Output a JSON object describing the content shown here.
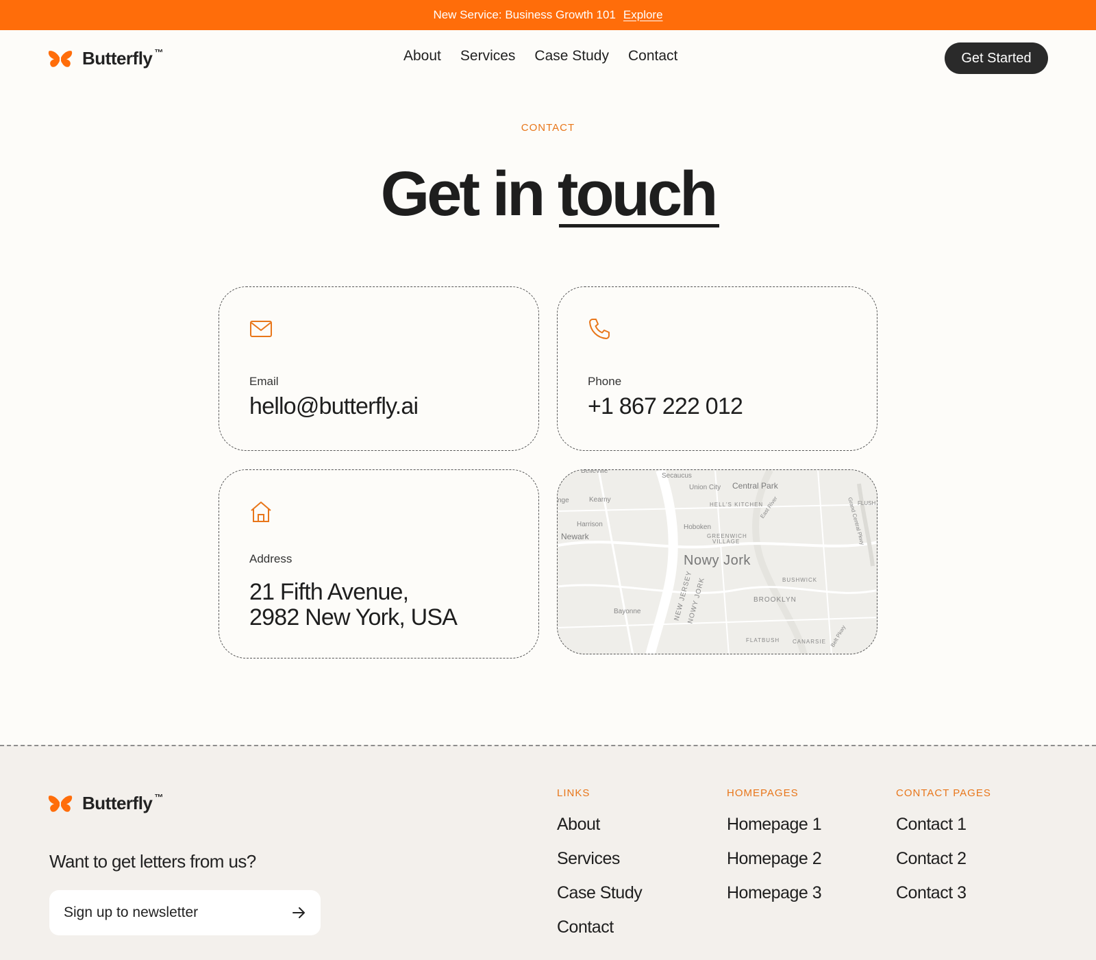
{
  "announcement": {
    "text": "New Service: Business Growth 101",
    "link": "Explore"
  },
  "brand": {
    "name": "Butterfly",
    "mark": "™",
    "accent": "#ff6d0a"
  },
  "nav": {
    "items": [
      "About",
      "Services",
      "Case Study",
      "Contact"
    ],
    "cta": "Get Started"
  },
  "hero": {
    "eyebrow": "CONTACT",
    "title_plain": "Get in ",
    "title_underlined": "touch"
  },
  "cards": {
    "email": {
      "icon": "mail-icon",
      "label": "Email",
      "value": "hello@butterfly.ai"
    },
    "phone": {
      "icon": "phone-icon",
      "label": "Phone",
      "value": "+1 867 222 012"
    },
    "address": {
      "icon": "home-icon",
      "label": "Address",
      "line1": "21 Fifth Avenue,",
      "line2": "2982 New York, USA"
    }
  },
  "map": {
    "main_city": "Nowy Jork",
    "places": [
      "Belleville",
      "Secaucus",
      "Union City",
      "Central Park",
      "Kearny",
      "HELL'S KITCHEN",
      "East River",
      "FLUSH",
      "Harrison",
      "Hoboken",
      "Newark",
      "GREENWICH",
      "VILLAGE",
      "Grand Central Pkwy",
      "BUSHWICK",
      "NEW JERSEY",
      "NOWY JORK",
      "BROOKLYN",
      "Bayonne",
      "FLATBUSH",
      "CANARSIE",
      "Belt Pkwy",
      "nge"
    ]
  },
  "footer": {
    "tagline": "Want to get letters from us?",
    "newsletter_placeholder": "Sign up to newsletter",
    "columns": [
      {
        "title": "LINKS",
        "items": [
          "About",
          "Services",
          "Case Study",
          "Contact"
        ]
      },
      {
        "title": "HOMEPAGES",
        "items": [
          "Homepage 1",
          "Homepage 2",
          "Homepage 3"
        ]
      },
      {
        "title": "CONTACT PAGES",
        "items": [
          "Contact 1",
          "Contact 2",
          "Contact 3"
        ]
      }
    ]
  }
}
